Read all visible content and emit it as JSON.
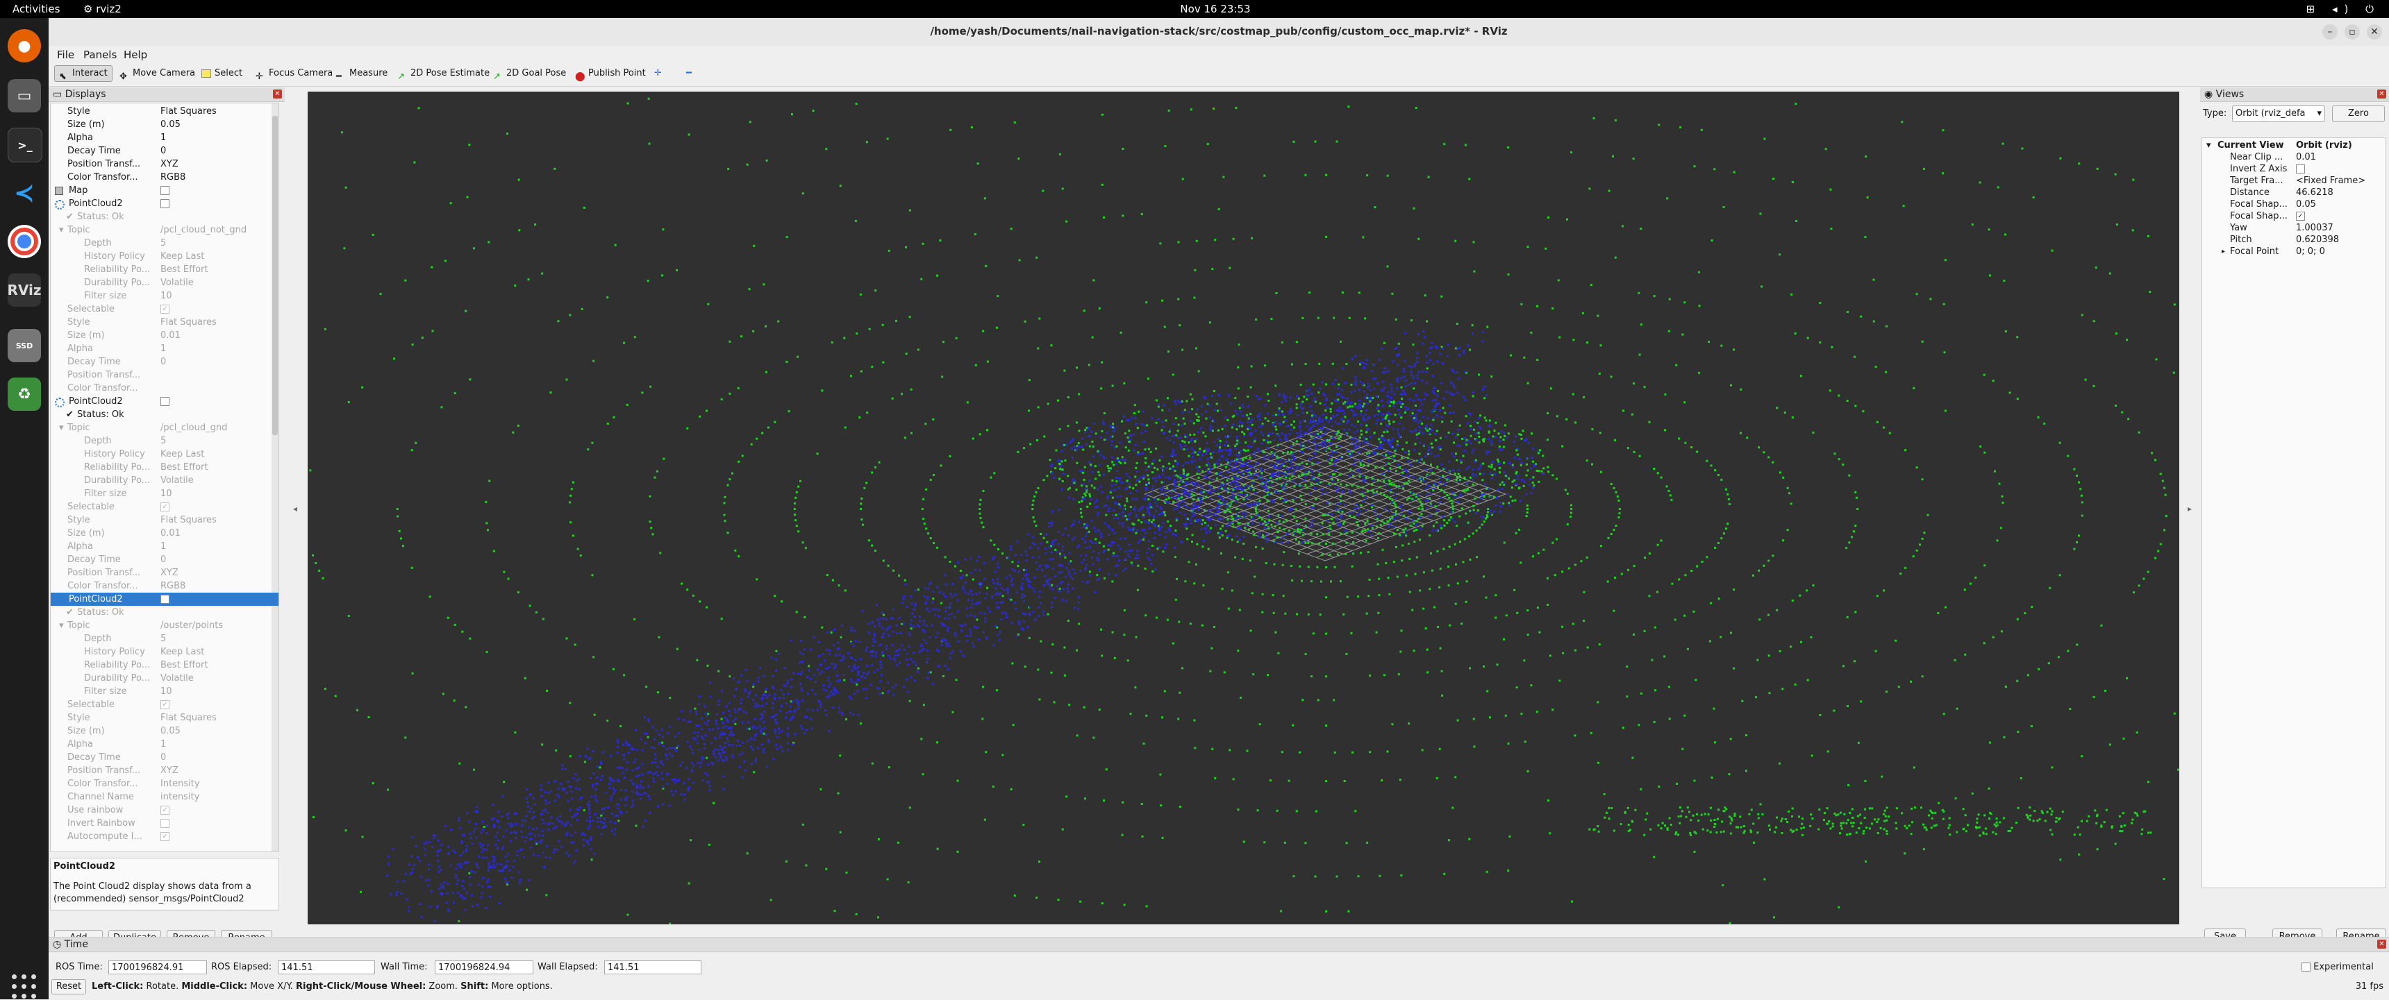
{
  "system": {
    "activities": "Activities",
    "app_name": "rviz2",
    "clock": "Nov 16  23:53"
  },
  "window": {
    "title": "/home/yash/Documents/nail-navigation-stack/src/costmap_pub/config/custom_occ_map.rviz* - RViz"
  },
  "menu": {
    "file": "File",
    "panels": "Panels",
    "help": "Help"
  },
  "toolbar": {
    "interact": "Interact",
    "move_camera": "Move Camera",
    "select": "Select",
    "focus_camera": "Focus Camera",
    "measure": "Measure",
    "pose_estimate": "2D Pose Estimate",
    "goal_pose": "2D Goal Pose",
    "publish_point": "Publish Point",
    "plus": "✛",
    "minus": "━"
  },
  "displays": {
    "title": "Displays",
    "rows": [
      {
        "k": "Style",
        "v": "Flat Squares",
        "lvl": 1
      },
      {
        "k": "Size (m)",
        "v": "0.05",
        "lvl": 1
      },
      {
        "k": "Alpha",
        "v": "1",
        "lvl": 1
      },
      {
        "k": "Decay Time",
        "v": "0",
        "lvl": 1
      },
      {
        "k": "Position Transf...",
        "v": "XYZ",
        "lvl": 1
      },
      {
        "k": "Color Transfor...",
        "v": "RGB8",
        "lvl": 1
      },
      {
        "k": "Map",
        "v": "",
        "lvl": 0,
        "cb": false,
        "icon": "map"
      },
      {
        "k": "PointCloud2",
        "v": "",
        "lvl": 0,
        "cb": false,
        "icon": "pc"
      },
      {
        "k": "Status: Ok",
        "v": "",
        "lvl": 1,
        "dim": true,
        "check": true
      },
      {
        "k": "Topic",
        "v": "/pcl_cloud_not_gnd",
        "lvl": 1,
        "dim": true,
        "arrow": true
      },
      {
        "k": "Depth",
        "v": "5",
        "lvl": 2,
        "dim": true
      },
      {
        "k": "History Policy",
        "v": "Keep Last",
        "lvl": 2,
        "dim": true
      },
      {
        "k": "Reliability Po...",
        "v": "Best Effort",
        "lvl": 2,
        "dim": true
      },
      {
        "k": "Durability Po...",
        "v": "Volatile",
        "lvl": 2,
        "dim": true
      },
      {
        "k": "Filter size",
        "v": "10",
        "lvl": 2,
        "dim": true
      },
      {
        "k": "Selectable",
        "v": "",
        "lvl": 1,
        "dim": true,
        "cb": true
      },
      {
        "k": "Style",
        "v": "Flat Squares",
        "lvl": 1,
        "dim": true
      },
      {
        "k": "Size (m)",
        "v": "0.01",
        "lvl": 1,
        "dim": true
      },
      {
        "k": "Alpha",
        "v": "1",
        "lvl": 1,
        "dim": true
      },
      {
        "k": "Decay Time",
        "v": "0",
        "lvl": 1,
        "dim": true
      },
      {
        "k": "Position Transf...",
        "v": "",
        "lvl": 1,
        "dim": true
      },
      {
        "k": "Color Transfor...",
        "v": "",
        "lvl": 1,
        "dim": true
      },
      {
        "k": "PointCloud2",
        "v": "",
        "lvl": 0,
        "cb": false,
        "icon": "pc"
      },
      {
        "k": "Status: Ok",
        "v": "",
        "lvl": 1,
        "check": true
      },
      {
        "k": "Topic",
        "v": "/pcl_cloud_gnd",
        "lvl": 1,
        "dim": true,
        "arrow": true
      },
      {
        "k": "Depth",
        "v": "5",
        "lvl": 2,
        "dim": true
      },
      {
        "k": "History Policy",
        "v": "Keep Last",
        "lvl": 2,
        "dim": true
      },
      {
        "k": "Reliability Po...",
        "v": "Best Effort",
        "lvl": 2,
        "dim": true
      },
      {
        "k": "Durability Po...",
        "v": "Volatile",
        "lvl": 2,
        "dim": true
      },
      {
        "k": "Filter size",
        "v": "10",
        "lvl": 2,
        "dim": true
      },
      {
        "k": "Selectable",
        "v": "",
        "lvl": 1,
        "dim": true,
        "cb": true
      },
      {
        "k": "Style",
        "v": "Flat Squares",
        "lvl": 1,
        "dim": true
      },
      {
        "k": "Size (m)",
        "v": "0.01",
        "lvl": 1,
        "dim": true
      },
      {
        "k": "Alpha",
        "v": "1",
        "lvl": 1,
        "dim": true
      },
      {
        "k": "Decay Time",
        "v": "0",
        "lvl": 1,
        "dim": true
      },
      {
        "k": "Position Transf...",
        "v": "XYZ",
        "lvl": 1,
        "dim": true
      },
      {
        "k": "Color Transfor...",
        "v": "RGB8",
        "lvl": 1,
        "dim": true
      },
      {
        "k": "PointCloud2",
        "v": "",
        "lvl": 0,
        "cb": false,
        "sel": true
      },
      {
        "k": "Status: Ok",
        "v": "",
        "lvl": 1,
        "dim": true,
        "check": true
      },
      {
        "k": "Topic",
        "v": "/ouster/points",
        "lvl": 1,
        "dim": true,
        "arrow": true
      },
      {
        "k": "Depth",
        "v": "5",
        "lvl": 2,
        "dim": true
      },
      {
        "k": "History Policy",
        "v": "Keep Last",
        "lvl": 2,
        "dim": true
      },
      {
        "k": "Reliability Po...",
        "v": "Best Effort",
        "lvl": 2,
        "dim": true
      },
      {
        "k": "Durability Po...",
        "v": "Volatile",
        "lvl": 2,
        "dim": true
      },
      {
        "k": "Filter size",
        "v": "10",
        "lvl": 2,
        "dim": true
      },
      {
        "k": "Selectable",
        "v": "",
        "lvl": 1,
        "dim": true,
        "cb": true
      },
      {
        "k": "Style",
        "v": "Flat Squares",
        "lvl": 1,
        "dim": true
      },
      {
        "k": "Size (m)",
        "v": "0.05",
        "lvl": 1,
        "dim": true
      },
      {
        "k": "Alpha",
        "v": "1",
        "lvl": 1,
        "dim": true
      },
      {
        "k": "Decay Time",
        "v": "0",
        "lvl": 1,
        "dim": true
      },
      {
        "k": "Position Transf...",
        "v": "XYZ",
        "lvl": 1,
        "dim": true
      },
      {
        "k": "Color Transfor...",
        "v": "Intensity",
        "lvl": 1,
        "dim": true
      },
      {
        "k": "Channel Name",
        "v": "intensity",
        "lvl": 1,
        "dim": true
      },
      {
        "k": "Use rainbow",
        "v": "",
        "lvl": 1,
        "dim": true,
        "cb": true
      },
      {
        "k": "Invert Rainbow",
        "v": "",
        "lvl": 1,
        "dim": true,
        "cb": false
      },
      {
        "k": "Autocompute I...",
        "v": "",
        "lvl": 1,
        "dim": true,
        "cb": true
      }
    ],
    "desc_title": "PointCloud2",
    "desc_text": "The Point Cloud2 display shows data from a (recommended) sensor_msgs/PointCloud2",
    "add": "Add",
    "duplicate": "Duplicate",
    "remove": "Remove",
    "rename": "Rename"
  },
  "views": {
    "title": "Views",
    "type_label": "Type:",
    "type_value": "Orbit (rviz_defa",
    "zero": "Zero",
    "current_view": "Current View",
    "current_view_value": "Orbit (rviz)",
    "rows": [
      {
        "k": "Near Clip ...",
        "v": "0.01"
      },
      {
        "k": "Invert Z Axis",
        "v": "",
        "cb": false
      },
      {
        "k": "Target Fra...",
        "v": "<Fixed Frame>"
      },
      {
        "k": "Distance",
        "v": "46.6218"
      },
      {
        "k": "Focal Shap...",
        "v": "0.05"
      },
      {
        "k": "Focal Shap...",
        "v": "",
        "cb": true
      },
      {
        "k": "Yaw",
        "v": "1.00037"
      },
      {
        "k": "Pitch",
        "v": "0.620398"
      },
      {
        "k": "Focal Point",
        "v": "0; 0; 0",
        "arrow": true
      }
    ],
    "save": "Save",
    "remove": "Remove",
    "rename": "Rename"
  },
  "time": {
    "title": "Time",
    "ros_time_label": "ROS Time:",
    "ros_time": "1700196824.91",
    "ros_elapsed_label": "ROS Elapsed:",
    "ros_elapsed": "141.51",
    "wall_time_label": "Wall Time:",
    "wall_time": "1700196824.94",
    "wall_elapsed_label": "Wall Elapsed:",
    "wall_elapsed": "141.51",
    "experimental": "Experimental",
    "reset": "Reset",
    "hint_a": "Left-Click:",
    "hint_b": " Rotate. ",
    "hint_c": "Middle-Click:",
    "hint_d": " Move X/Y. ",
    "hint_e": "Right-Click/Mouse Wheel:",
    "hint_f": " Zoom. ",
    "hint_g": "Shift:",
    "hint_h": " More options.",
    "fps": "31 fps"
  },
  "colors": {
    "viewport_bg": "#303030",
    "green_points": "#1fd61f",
    "blue_points": "#2b2bd6",
    "grid": "#9a9a9a",
    "selection": "#2e7bcf"
  }
}
